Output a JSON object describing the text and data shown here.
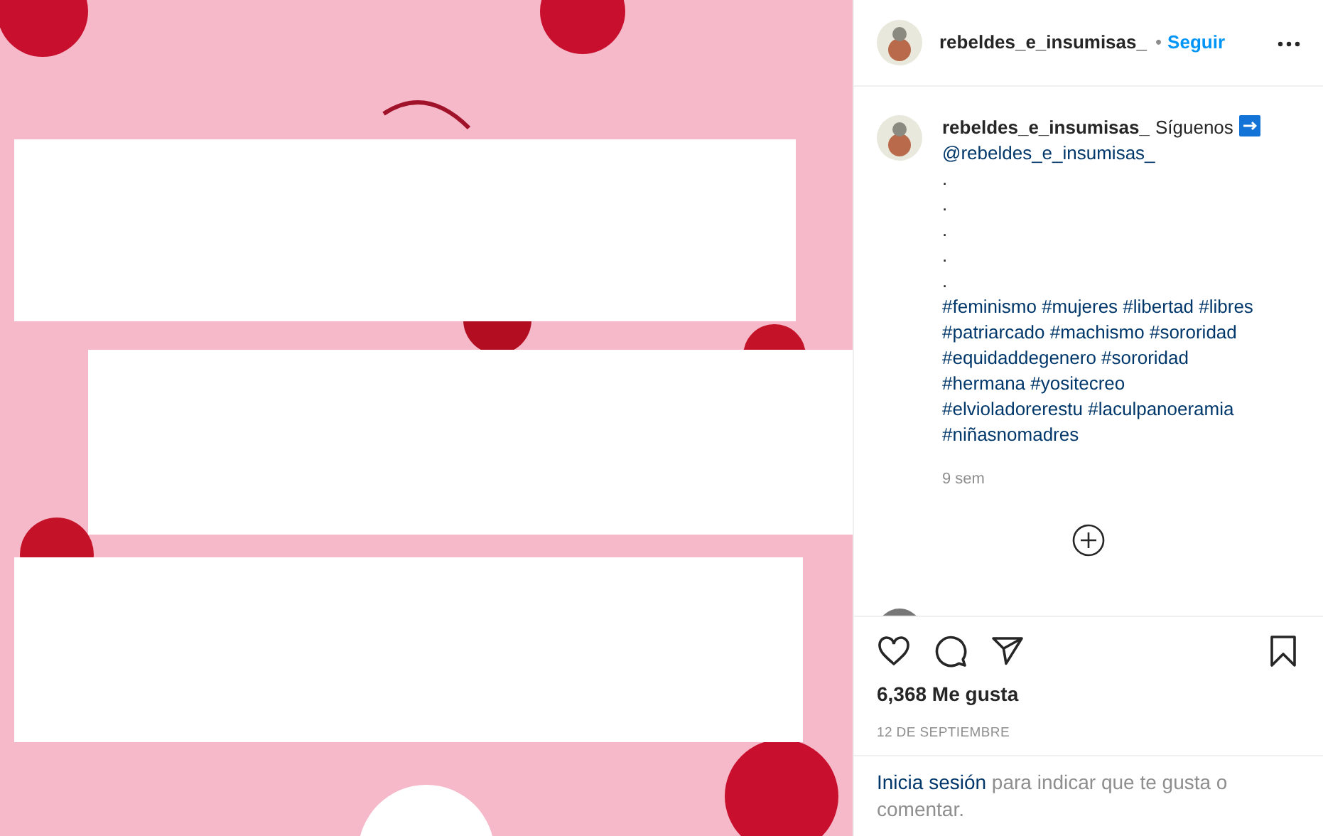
{
  "header": {
    "username": "rebeldes_e_insumisas_",
    "separator": "•",
    "follow": "Seguir"
  },
  "caption": {
    "username": "rebeldes_e_insumisas_",
    "text": "Síguenos",
    "mention": "@rebeldes_e_insumisas_",
    "dot_lines": [
      ".",
      ".",
      ".",
      ".",
      "."
    ],
    "hashtag_lines": [
      "#feminismo #mujeres #libertad #libres",
      "#patriarcado #machismo #sororidad",
      "#equidaddegenero #sororidad",
      "#hermana #yositecreo",
      "#elvioladorerestu #laculpanoeramia",
      "#niñasnomadres"
    ],
    "time": "9 sem"
  },
  "actions": {
    "liked": false,
    "saved": false
  },
  "likes": "6,368 Me gusta",
  "date": "12 DE SEPTIEMBRE",
  "login": {
    "link": "Inicia sesión",
    "text": "para indicar que te gusta o comentar."
  }
}
